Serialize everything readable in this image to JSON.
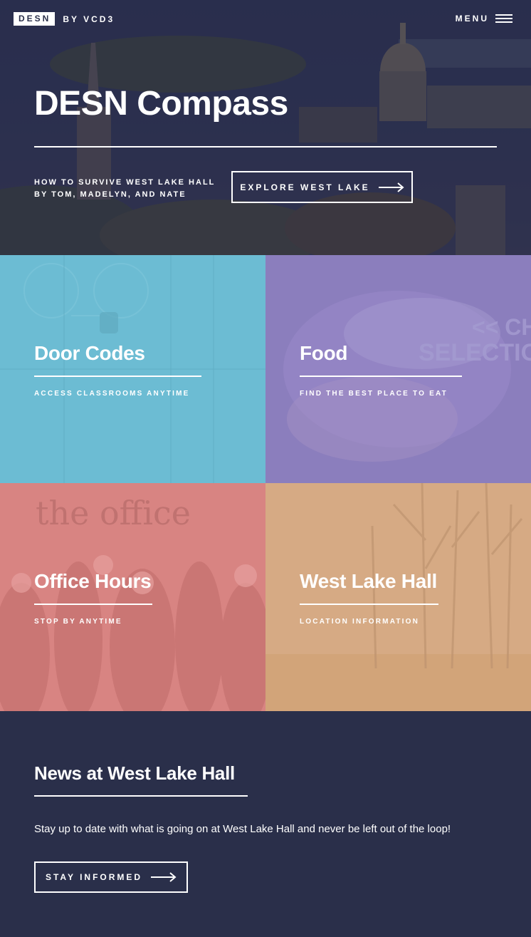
{
  "header": {
    "logo_box": "DESN",
    "logo_by": "BY VCD3",
    "menu_label": "MENU"
  },
  "hero": {
    "title": "DESN Compass",
    "subtitle_line1": "HOW TO SURVIVE WEST LAKE HALL",
    "subtitle_line2": "BY TOM, MADELYN, AND NATE",
    "button_label": "EXPLORE WEST LAKE"
  },
  "tiles": [
    {
      "title": "Door Codes",
      "subtitle": "ACCESS CLASSROOMS ANYTIME",
      "color": "#6cbcd3"
    },
    {
      "title": "Food",
      "subtitle": "FIND THE BEST PLACE TO EAT",
      "color": "#8b7ebd",
      "sign_line1": "<< CHE",
      "sign_line2": "SELECTION"
    },
    {
      "title": "Office Hours",
      "subtitle": "STOP BY ANYTIME",
      "color": "#d88482",
      "sign_text": "the office"
    },
    {
      "title": "West Lake Hall",
      "subtitle": "LOCATION INFORMATION",
      "color": "#d6aa84"
    }
  ],
  "news": {
    "title": "News at West Lake Hall",
    "text": "Stay up to date with what is going on at West Lake Hall and never be left out of the loop!",
    "button_label": "STAY INFORMED"
  },
  "colors": {
    "navy": "#2a2f4a",
    "white": "#ffffff"
  }
}
